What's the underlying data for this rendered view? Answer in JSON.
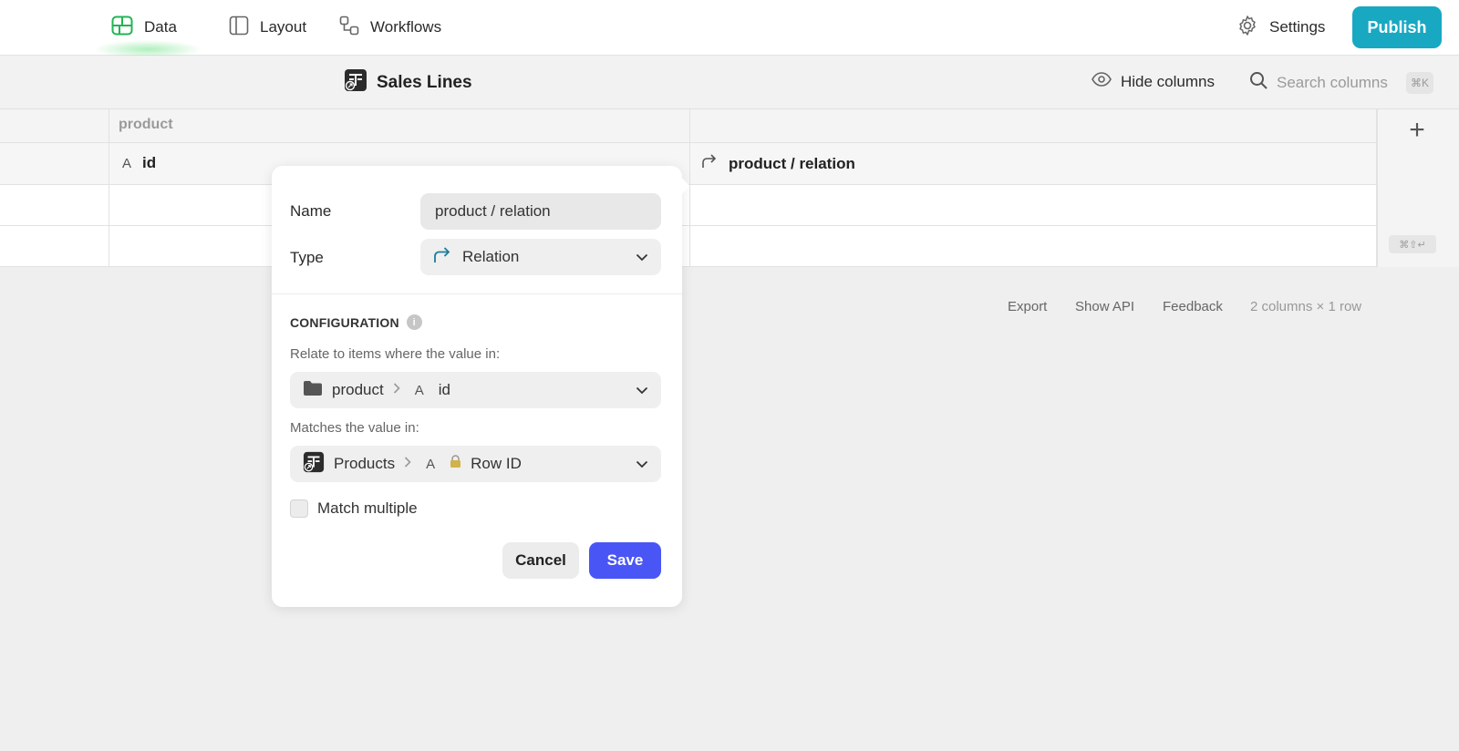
{
  "nav": {
    "data_label": "Data",
    "layout_label": "Layout",
    "workflows_label": "Workflows",
    "settings_label": "Settings",
    "publish_label": "Publish",
    "accent_color": "#18a8c2",
    "data_icon_color": "#22b455"
  },
  "toolbar": {
    "table_title": "Sales Lines",
    "hide_columns_label": "Hide columns",
    "search_placeholder": "Search columns",
    "search_shortcut": "⌘K"
  },
  "grid": {
    "group_label": "product",
    "columns": [
      {
        "type_icon": "text-type-icon",
        "type_glyph": "A",
        "label": "id"
      },
      {
        "type_icon": "relation-icon",
        "label": "product / relation"
      }
    ],
    "add_column_symbol": "+",
    "add_row_shortcut": "⌘⇧↵"
  },
  "footer": {
    "export_label": "Export",
    "show_api_label": "Show API",
    "feedback_label": "Feedback",
    "summary": "2 columns × 1 row"
  },
  "popover": {
    "name_label": "Name",
    "name_value": "product / relation",
    "type_label": "Type",
    "type_value": "Relation",
    "config_title": "CONFIGURATION",
    "info_glyph": "i",
    "relate_hint": "Relate to items where the value in:",
    "relate_source": "product",
    "relate_type_glyph": "A",
    "relate_column": "id",
    "matches_hint": "Matches the value in:",
    "match_table": "Products",
    "match_type_glyph": "A",
    "match_column": "Row ID",
    "match_multiple_label": "Match multiple",
    "match_multiple_checked": false,
    "cancel_label": "Cancel",
    "save_label": "Save",
    "save_color": "#4a55f5"
  }
}
